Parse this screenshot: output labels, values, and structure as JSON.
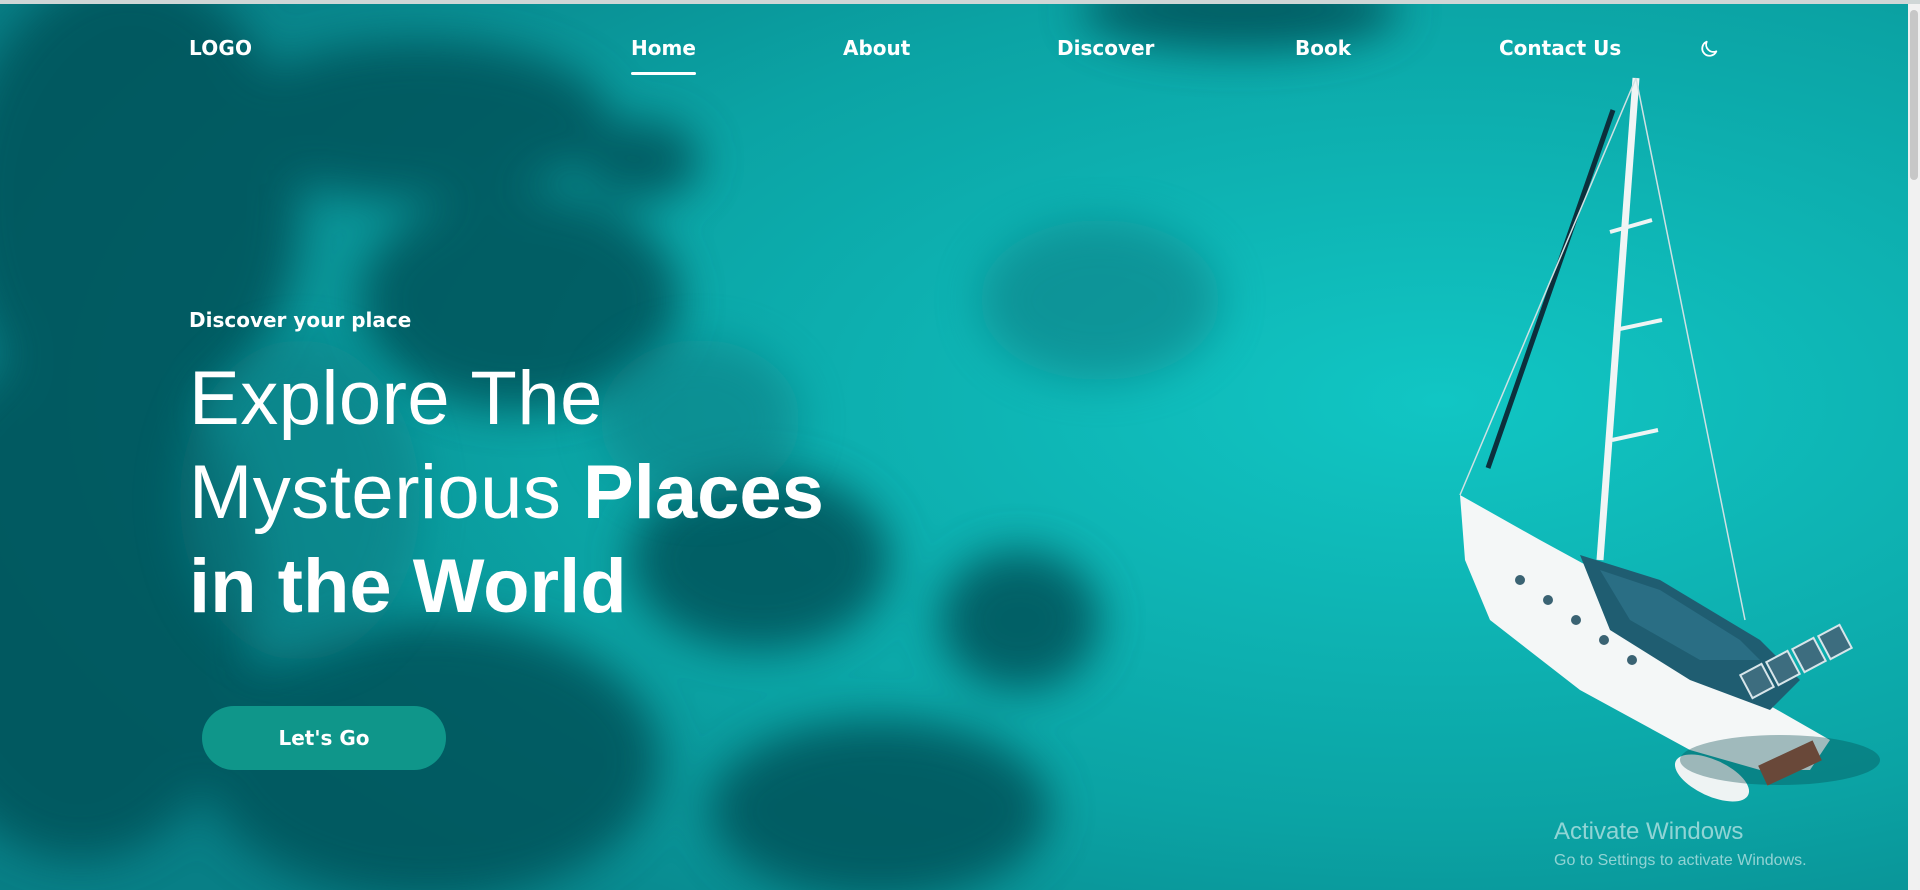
{
  "header": {
    "logo": "LOGO",
    "nav": [
      {
        "label": "Home",
        "active": true
      },
      {
        "label": "About",
        "active": false
      },
      {
        "label": "Discover",
        "active": false
      },
      {
        "label": "Book",
        "active": false
      },
      {
        "label": "Contact Us",
        "active": false
      }
    ],
    "theme_toggle_icon": "moon-icon"
  },
  "hero": {
    "subtitle": "Discover your place",
    "headline": {
      "line1": "Explore The",
      "line2_light": "Mysterious ",
      "line2_bold": "Places",
      "line3": "in the World"
    },
    "cta_label": "Let's Go",
    "background": "aerial turquoise sea with sailing yacht"
  },
  "watermark": {
    "title": "Activate Windows",
    "subtitle": "Go to Settings to activate Windows."
  },
  "colors": {
    "sea": "#0aa6a6",
    "deep_sea": "#064c52",
    "accent": "#0f968a",
    "text": "#ffffff"
  }
}
